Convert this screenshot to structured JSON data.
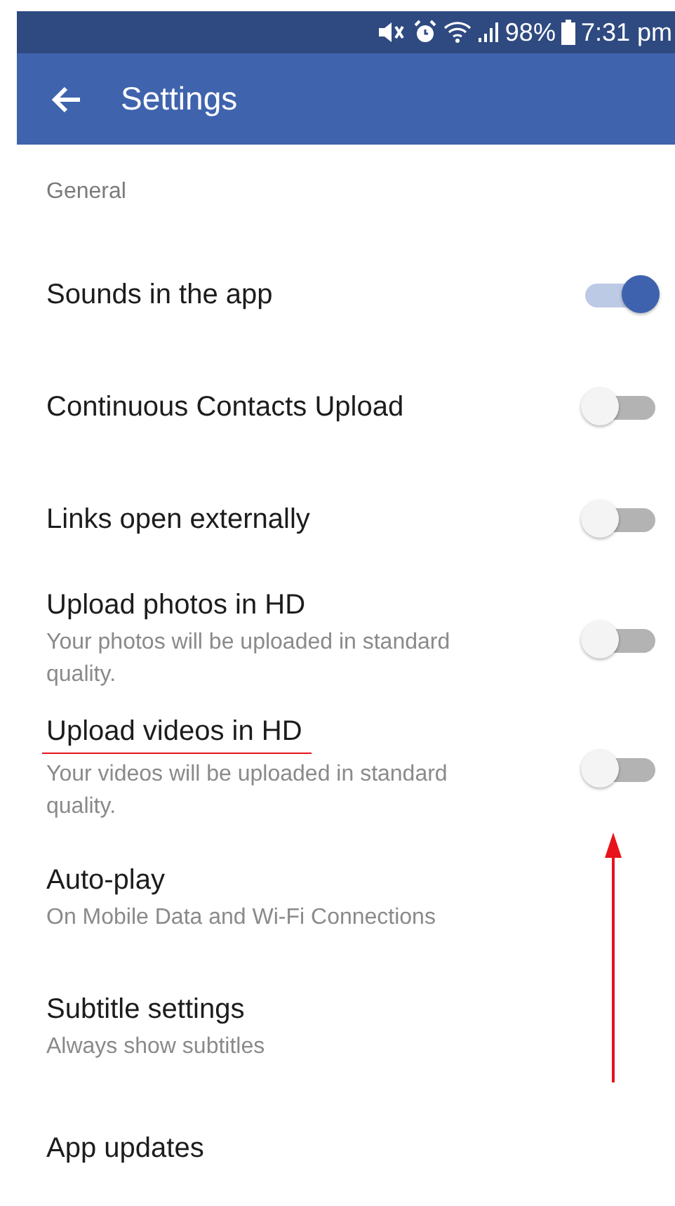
{
  "status_bar": {
    "battery": "98%",
    "time": "7:31 pm"
  },
  "app_bar": {
    "title": "Settings"
  },
  "section": {
    "header": "General"
  },
  "rows": [
    {
      "title": "Sounds in the app",
      "kind": "toggle",
      "on": true
    },
    {
      "title": "Continuous Contacts Upload",
      "kind": "toggle",
      "on": false
    },
    {
      "title": "Links open externally",
      "kind": "toggle",
      "on": false
    },
    {
      "title": "Upload photos in HD",
      "subtitle": "Your photos will be uploaded in standard quality.",
      "kind": "toggle",
      "on": false
    },
    {
      "title": "Upload videos in HD",
      "subtitle": "Your videos will be uploaded in standard quality.",
      "kind": "toggle",
      "on": false,
      "underlined": true
    },
    {
      "title": "Auto-play",
      "subtitle": "On Mobile Data and Wi-Fi Connections",
      "kind": "link"
    },
    {
      "title": "Subtitle settings",
      "subtitle": "Always show subtitles",
      "kind": "link"
    },
    {
      "title": "App updates",
      "kind": "link"
    }
  ],
  "annotations": [
    {
      "kind": "arrow"
    }
  ]
}
